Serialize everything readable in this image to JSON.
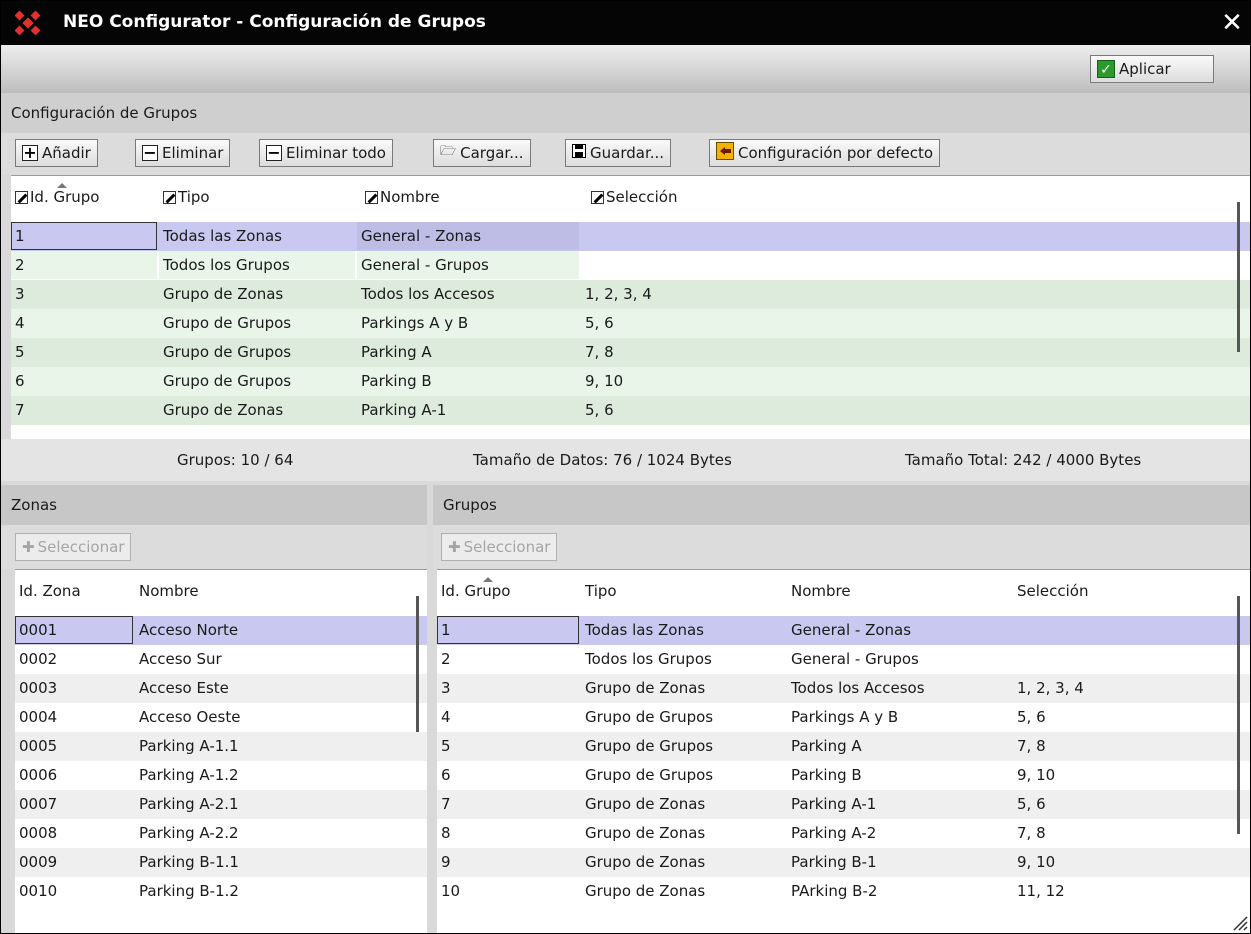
{
  "window": {
    "title": "NEO Configurator - Configuración de Grupos",
    "close_symbol": "✕"
  },
  "top_toolbar": {
    "apply_label": "Aplicar"
  },
  "config_section": {
    "title": "Configuración de Grupos"
  },
  "toolbar": {
    "add_label": "Añadir",
    "delete_label": "Eliminar",
    "delete_all_label": "Eliminar todo",
    "load_label": "Cargar...",
    "save_label": "Guardar...",
    "default_label": "Configuración por defecto"
  },
  "groups_table": {
    "columns": [
      "Id. Grupo",
      "Tipo",
      "Nombre",
      "Selección"
    ],
    "rows": [
      [
        "1",
        "Todas las Zonas",
        "General - Zonas",
        ""
      ],
      [
        "2",
        "Todos los Grupos",
        "General - Grupos",
        ""
      ],
      [
        "3",
        "Grupo de Zonas",
        "Todos los Accesos",
        "1, 2, 3, 4"
      ],
      [
        "4",
        "Grupo de Grupos",
        "Parkings A y B",
        "5, 6"
      ],
      [
        "5",
        "Grupo de Grupos",
        "Parking A",
        "7, 8"
      ],
      [
        "6",
        "Grupo de Grupos",
        "Parking B",
        "9, 10"
      ],
      [
        "7",
        "Grupo de Zonas",
        "Parking A-1",
        "5, 6"
      ]
    ]
  },
  "status": {
    "groups": "Grupos: 10 / 64",
    "data_size": "Tamaño de Datos: 76 / 1024 Bytes",
    "total_size": "Tamaño Total: 242 / 4000 Bytes"
  },
  "zones_panel": {
    "title": "Zonas",
    "select_label": "Seleccionar",
    "columns": [
      "Id. Zona",
      "Nombre"
    ],
    "rows": [
      [
        "0001",
        "Acceso Norte"
      ],
      [
        "0002",
        "Acceso Sur"
      ],
      [
        "0003",
        "Acceso Este"
      ],
      [
        "0004",
        "Acceso Oeste"
      ],
      [
        "0005",
        "Parking A-1.1"
      ],
      [
        "0006",
        "Parking A-1.2"
      ],
      [
        "0007",
        "Parking A-2.1"
      ],
      [
        "0008",
        "Parking A-2.2"
      ],
      [
        "0009",
        "Parking B-1.1"
      ],
      [
        "0010",
        "Parking B-1.2"
      ]
    ]
  },
  "groups_panel": {
    "title": "Grupos",
    "select_label": "Seleccionar",
    "columns": [
      "Id. Grupo",
      "Tipo",
      "Nombre",
      "Selección"
    ],
    "rows": [
      [
        "1",
        "Todas las Zonas",
        "General - Zonas",
        ""
      ],
      [
        "2",
        "Todos los Grupos",
        "General - Grupos",
        ""
      ],
      [
        "3",
        "Grupo de Zonas",
        "Todos los Accesos",
        "1, 2, 3, 4"
      ],
      [
        "4",
        "Grupo de Grupos",
        "Parkings A y B",
        "5, 6"
      ],
      [
        "5",
        "Grupo de Grupos",
        "Parking A",
        "7, 8"
      ],
      [
        "6",
        "Grupo de Grupos",
        "Parking B",
        "9, 10"
      ],
      [
        "7",
        "Grupo de Zonas",
        "Parking A-1",
        "5, 6"
      ],
      [
        "8",
        "Grupo de Zonas",
        "Parking A-2",
        "7, 8"
      ],
      [
        "9",
        "Grupo de Zonas",
        "Parking B-1",
        "9, 10"
      ],
      [
        "10",
        "Grupo de Zonas",
        "PArking B-2",
        "11, 12"
      ]
    ]
  },
  "colors": {
    "selected_row": "#c8c8f0",
    "green_row_a": "#dcebdc",
    "green_row_b": "#e8f5e8",
    "gray_row": "#efefef"
  }
}
